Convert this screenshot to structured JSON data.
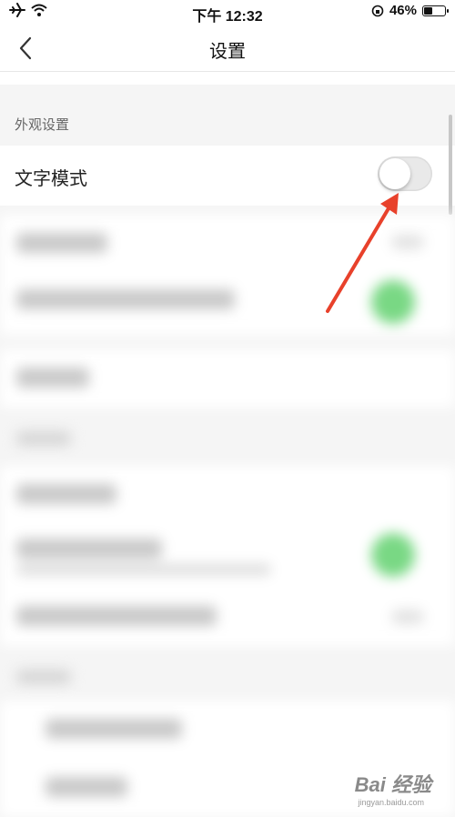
{
  "status_bar": {
    "time": "下午 12:32",
    "battery_percent": "46%",
    "battery_level": 0.46
  },
  "nav": {
    "title": "设置"
  },
  "section": {
    "header": "外观设置"
  },
  "settings": {
    "text_mode_label": "文字模式",
    "text_mode_on": false
  },
  "watermark": {
    "text": "Bai 经验",
    "sub": "jingyan.baidu.com"
  },
  "colors": {
    "arrow": "#e8412b",
    "toggle_on_blurred": "#79d884"
  }
}
